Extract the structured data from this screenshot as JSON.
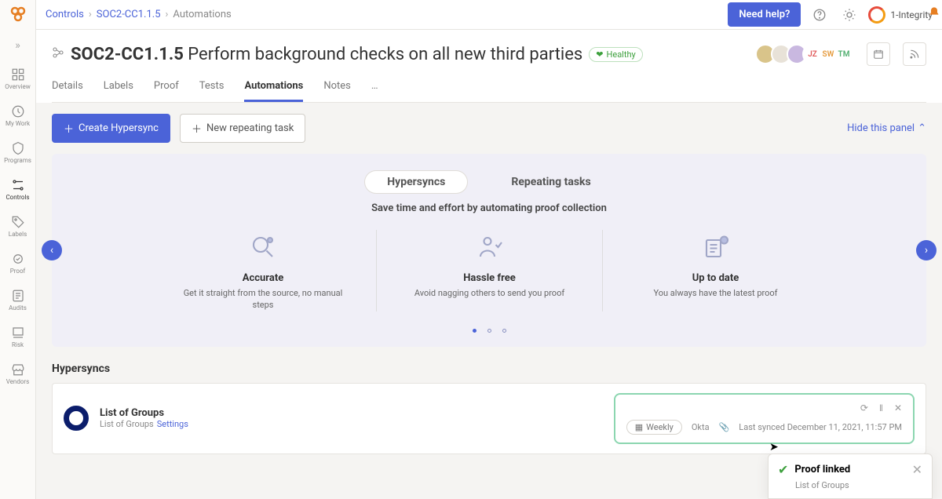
{
  "breadcrumb": {
    "level1": "Controls",
    "level2": "SOC2-CC1.1.5",
    "level3": "Automations"
  },
  "topbar": {
    "need_help": "Need help?",
    "org": "1-Integrity"
  },
  "sidebar": {
    "items": [
      {
        "label": "Overview"
      },
      {
        "label": "My Work"
      },
      {
        "label": "Programs"
      },
      {
        "label": "Controls"
      },
      {
        "label": "Labels"
      },
      {
        "label": "Proof"
      },
      {
        "label": "Audits"
      },
      {
        "label": "Risk"
      },
      {
        "label": "Vendors"
      }
    ]
  },
  "page": {
    "code": "SOC2-CC1.1.5",
    "title_rest": "Perform background checks on all new third parties",
    "health": "Healthy",
    "avatars": [
      {
        "text": "",
        "bg": "#d9c48a"
      },
      {
        "text": "",
        "bg": "#e8e2d8"
      },
      {
        "text": "",
        "bg": "#c9b8e0"
      },
      {
        "text": "JZ",
        "bg": "#fff",
        "color": "#e05a5a"
      },
      {
        "text": "SW",
        "bg": "#fff",
        "color": "#e59a3c"
      },
      {
        "text": "TM",
        "bg": "#fff",
        "color": "#4fae6e"
      }
    ]
  },
  "tabs": [
    "Details",
    "Labels",
    "Proof",
    "Tests",
    "Automations",
    "Notes",
    "…"
  ],
  "active_tab": "Automations",
  "actions": {
    "create": "Create Hypersync",
    "new_task": "New repeating task",
    "hide": "Hide this panel"
  },
  "panel": {
    "seg": [
      "Hypersyncs",
      "Repeating tasks"
    ],
    "seg_active": "Hypersyncs",
    "tagline": "Save time and effort by automating proof collection",
    "features": [
      {
        "title": "Accurate",
        "desc": "Get it straight from the source, no manual steps"
      },
      {
        "title": "Hassle free",
        "desc": "Avoid nagging others to send you proof"
      },
      {
        "title": "Up to date",
        "desc": "You always have the latest proof"
      }
    ]
  },
  "hypersyncs": {
    "section": "Hypersyncs",
    "item": {
      "name": "List of Groups",
      "sub": "List of Groups",
      "settings": "Settings",
      "frequency": "Weekly",
      "source": "Okta",
      "synced": "Last synced December 11, 2021, 11:57 PM"
    }
  },
  "toast": {
    "title": "Proof linked",
    "sub": "List of Groups"
  }
}
